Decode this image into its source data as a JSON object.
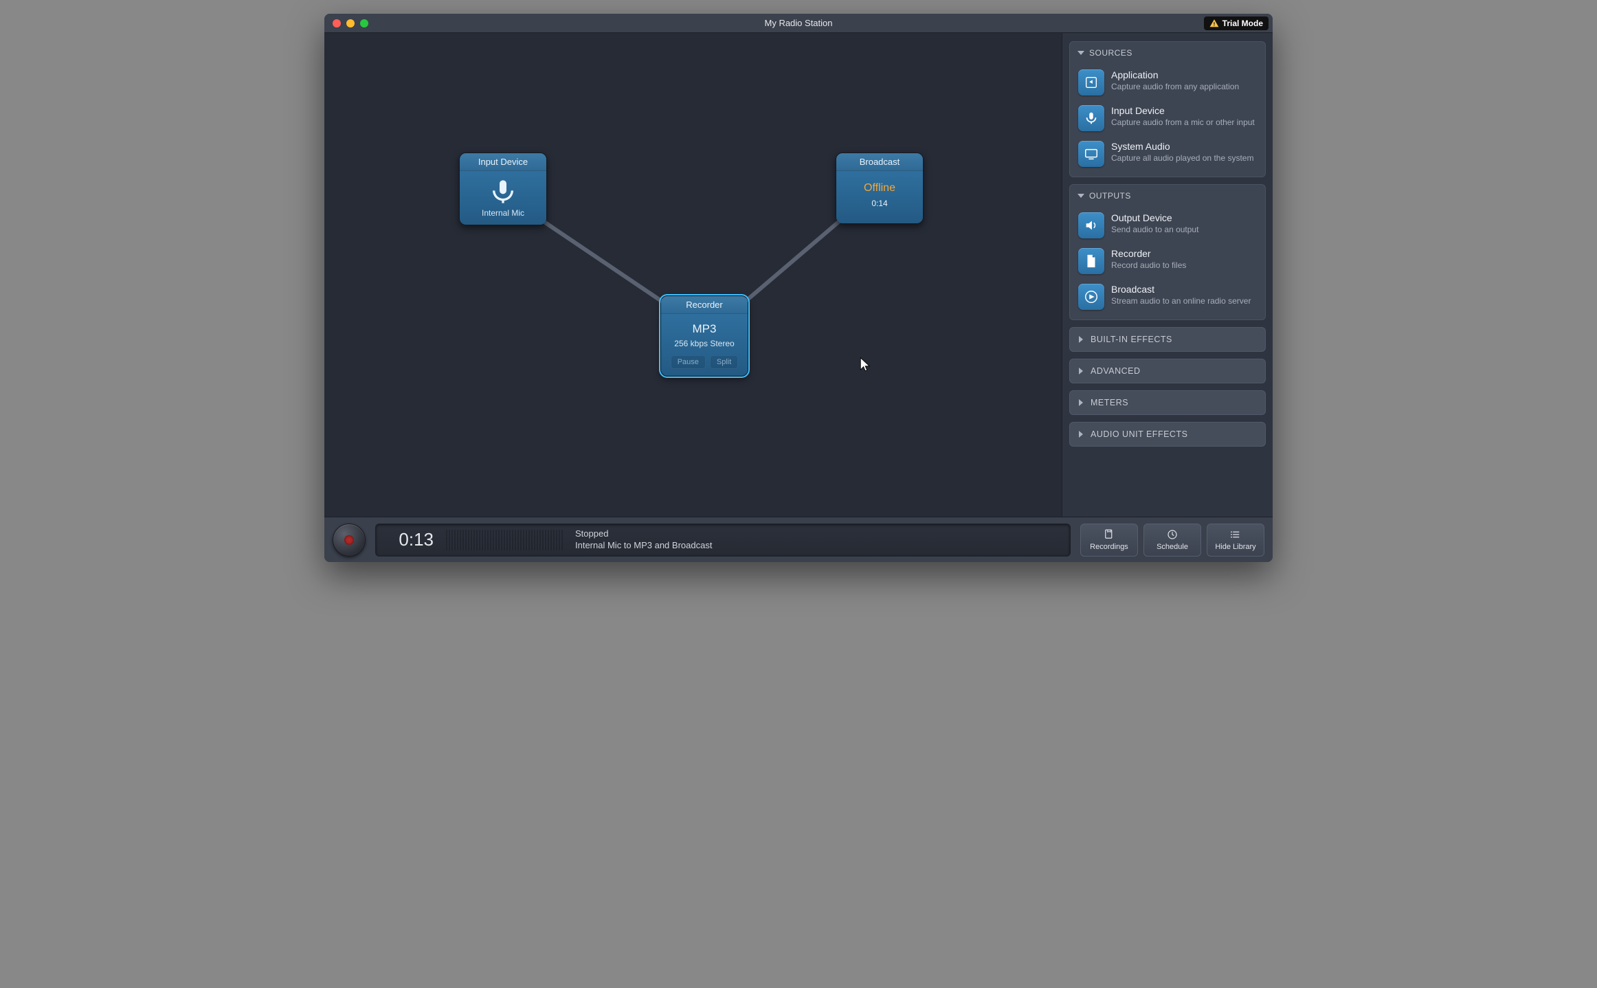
{
  "window": {
    "title": "My Radio Station",
    "trial_label": "Trial Mode"
  },
  "nodes": {
    "input": {
      "title": "Input Device",
      "label": "Internal Mic"
    },
    "recorder": {
      "title": "Recorder",
      "format": "MP3",
      "detail": "256 kbps Stereo",
      "pause_label": "Pause",
      "split_label": "Split"
    },
    "broadcast": {
      "title": "Broadcast",
      "status": "Offline",
      "time": "0:14"
    }
  },
  "library": {
    "sources": {
      "header": "SOURCES",
      "items": [
        {
          "title": "Application",
          "desc": "Capture audio from any application"
        },
        {
          "title": "Input Device",
          "desc": "Capture audio from a mic or other input"
        },
        {
          "title": "System Audio",
          "desc": "Capture all audio played on the system"
        }
      ]
    },
    "outputs": {
      "header": "OUTPUTS",
      "items": [
        {
          "title": "Output Device",
          "desc": "Send audio to an output"
        },
        {
          "title": "Recorder",
          "desc": "Record audio to files"
        },
        {
          "title": "Broadcast",
          "desc": "Stream audio to an online radio server"
        }
      ]
    },
    "collapsed": [
      "BUILT-IN EFFECTS",
      "ADVANCED",
      "METERS",
      "AUDIO UNIT EFFECTS"
    ]
  },
  "footer": {
    "time": "0:13",
    "state": "Stopped",
    "route": "Internal Mic to MP3 and Broadcast",
    "buttons": {
      "recordings": "Recordings",
      "schedule": "Schedule",
      "hide_library": "Hide Library"
    }
  }
}
